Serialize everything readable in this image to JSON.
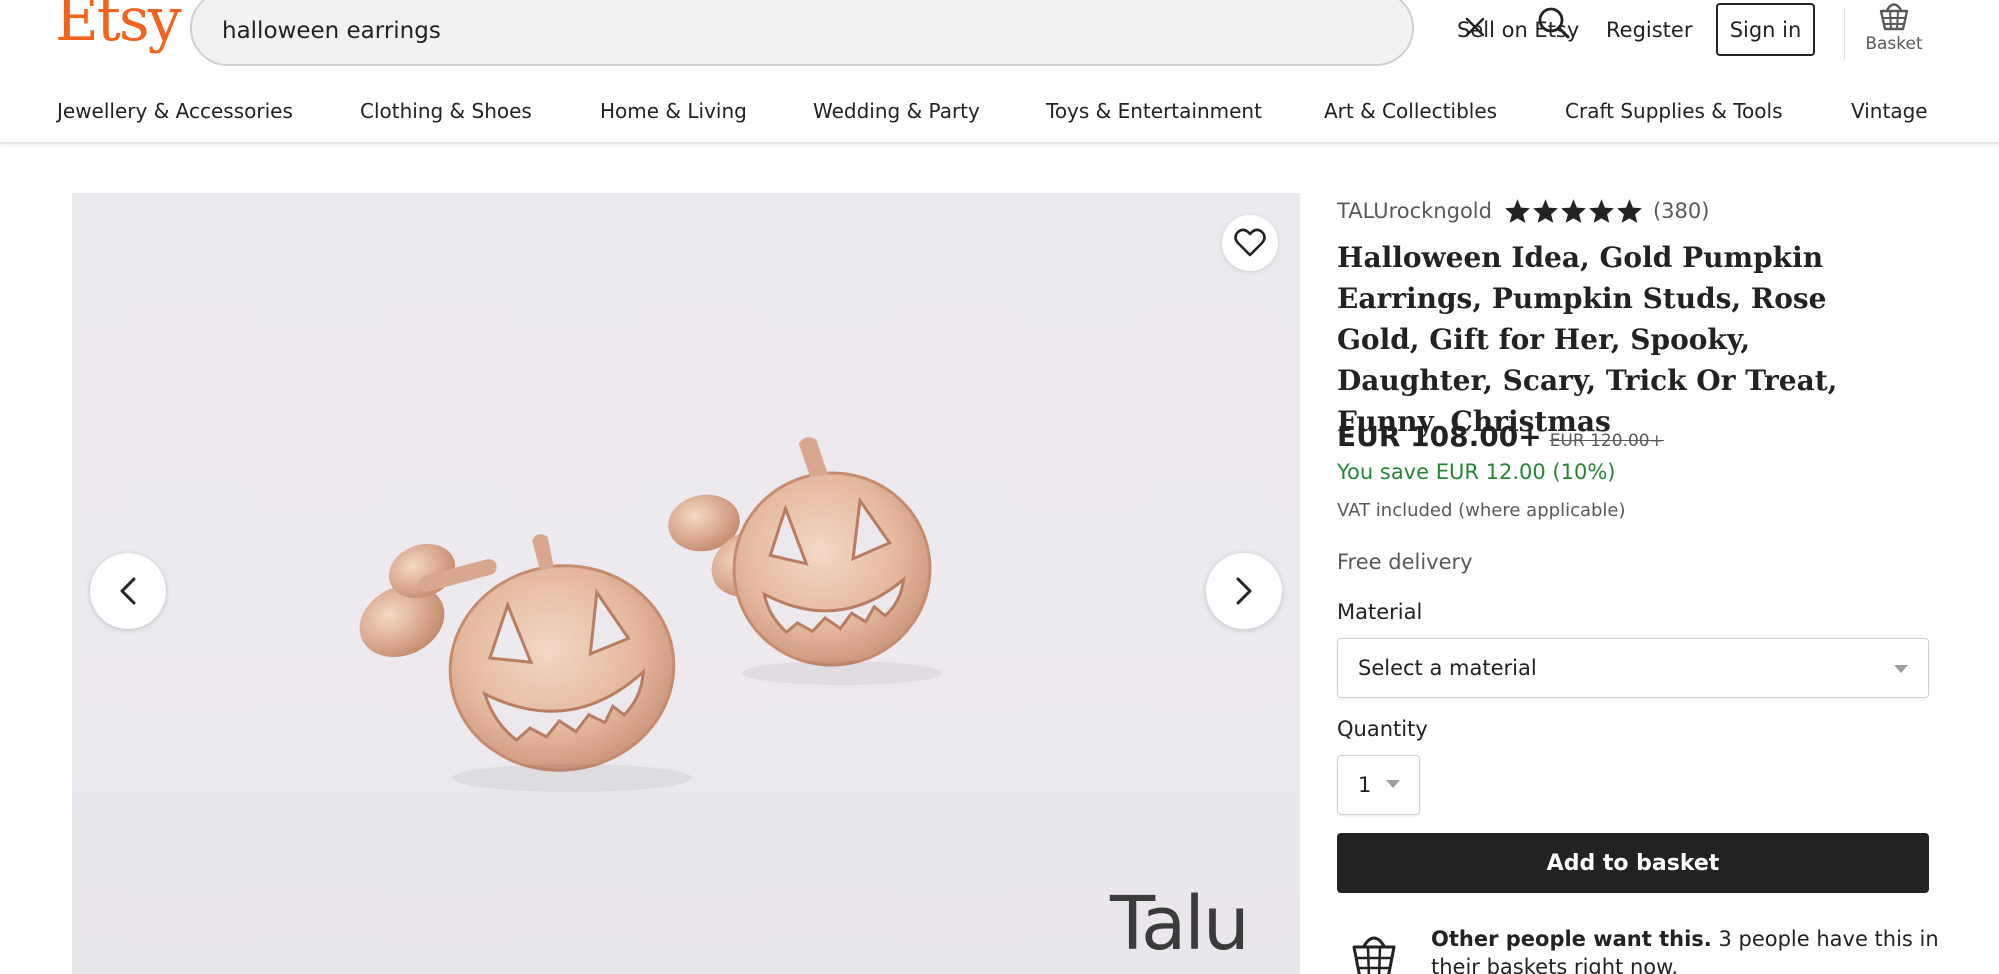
{
  "header": {
    "logo": "Etsy",
    "search": {
      "value": "halloween earrings"
    },
    "sell_label": "Sell on Etsy",
    "register_label": "Register",
    "signin_label": "Sign in",
    "basket_label": "Basket"
  },
  "categories": [
    "Jewellery & Accessories",
    "Clothing & Shoes",
    "Home & Living",
    "Wedding & Party",
    "Toys & Entertainment",
    "Art & Collectibles",
    "Craft Supplies & Tools",
    "Vintage"
  ],
  "gallery": {
    "watermark": "Talu"
  },
  "product": {
    "seller": "TALUrockngold",
    "rating_stars": 5,
    "review_count": "(380)",
    "title": "Halloween Idea, Gold Pumpkin Earrings, Pumpkin Studs, Rose Gold, Gift for Her, Spooky, Daughter, Scary, Trick Or Treat, Funny, Christmas",
    "price": "EUR 108.00+",
    "original_price": "EUR 120.00+",
    "savings": "You save EUR 12.00 (10%)",
    "vat_note": "VAT included (where applicable)",
    "delivery": "Free delivery",
    "material_label": "Material",
    "material_placeholder": "Select a material",
    "quantity_label": "Quantity",
    "quantity_value": "1",
    "add_to_basket": "Add to basket",
    "demand_bold": "Other people want this.",
    "demand_text": " 3 people have this in their baskets right now."
  },
  "colors": {
    "brand": "#F1641E",
    "savings": "#258635",
    "button": "#222222"
  }
}
